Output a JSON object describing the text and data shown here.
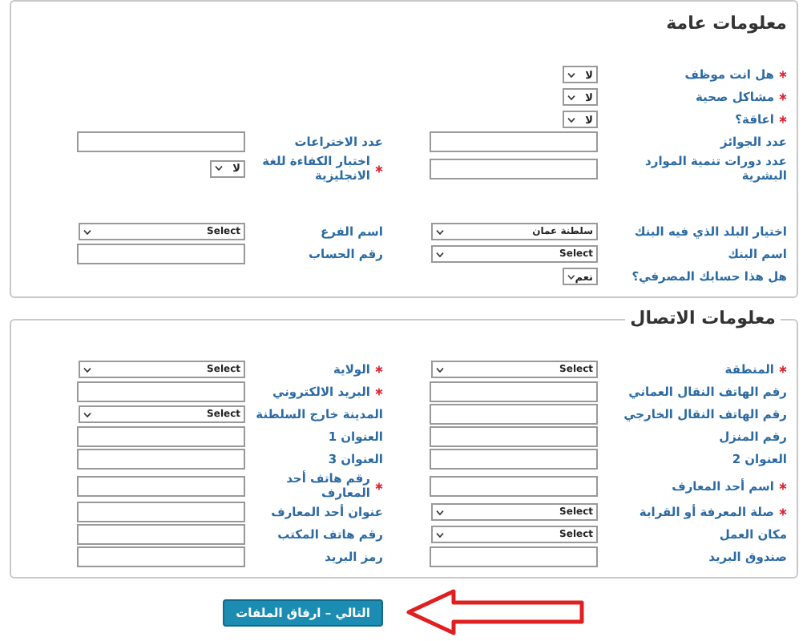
{
  "sections": [
    {
      "title": "معلومات عامة",
      "kind": "box",
      "rows": [
        {
          "kind": "fields",
          "cells": [
            {
              "label": "هل انت موظف",
              "required": true,
              "control": {
                "kind": "small-select",
                "value": "لا"
              }
            }
          ]
        },
        {
          "kind": "fields",
          "cells": [
            {
              "label": "مشاكل صحية",
              "required": true,
              "control": {
                "kind": "small-select",
                "value": "لا"
              }
            }
          ]
        },
        {
          "kind": "fields",
          "cells": [
            {
              "label": "اعاقة؟",
              "required": true,
              "control": {
                "kind": "small-select",
                "value": "لا"
              }
            }
          ]
        },
        {
          "kind": "fields",
          "cells": [
            {
              "label": "عدد الجوائز",
              "required": false,
              "control": {
                "kind": "input"
              }
            },
            {
              "label": "عدد الاختراعات",
              "required": false,
              "control": {
                "kind": "input"
              }
            }
          ]
        },
        {
          "kind": "fields",
          "cells": [
            {
              "label": "عدد دورات تنمية الموارد البشرية",
              "required": false,
              "control": {
                "kind": "input"
              }
            },
            {
              "label": "اختبار الكفاءة للغة الانجليزية",
              "required": true,
              "control": {
                "kind": "small-select",
                "value": "لا"
              }
            }
          ]
        },
        {
          "kind": "gap"
        },
        {
          "kind": "fields",
          "cells": [
            {
              "label": "اختيار البلد الذي فيه البنك",
              "required": false,
              "control": {
                "kind": "select",
                "value": "سلطنة عمان"
              }
            },
            {
              "label": "اسم الفرع",
              "required": false,
              "control": {
                "kind": "select",
                "value": "Select"
              }
            }
          ]
        },
        {
          "kind": "fields",
          "cells": [
            {
              "label": "اسم البنك",
              "required": false,
              "control": {
                "kind": "select",
                "value": "Select"
              }
            },
            {
              "label": "رقم الحساب",
              "required": false,
              "control": {
                "kind": "input"
              }
            }
          ]
        },
        {
          "kind": "fields",
          "cells": [
            {
              "label": "هل هذا حسابك المصرفي؟",
              "required": false,
              "control": {
                "kind": "small-select",
                "value": "نعم"
              }
            }
          ]
        }
      ]
    },
    {
      "title": "معلومات الاتصال",
      "kind": "fieldset",
      "rows": [
        {
          "kind": "fields",
          "cells": [
            {
              "label": "المنطقة",
              "required": true,
              "control": {
                "kind": "select",
                "value": "Select"
              }
            },
            {
              "label": "الولاية",
              "required": true,
              "control": {
                "kind": "select",
                "value": "Select"
              }
            }
          ]
        },
        {
          "kind": "fields",
          "cells": [
            {
              "label": "رقم الهاتف النقال العماني",
              "required": false,
              "control": {
                "kind": "input"
              }
            },
            {
              "label": "البريد الالكتروني",
              "required": true,
              "control": {
                "kind": "input"
              }
            }
          ]
        },
        {
          "kind": "fields",
          "cells": [
            {
              "label": "رقم الهاتف النقال الخارجي",
              "required": false,
              "control": {
                "kind": "input"
              }
            },
            {
              "label": "المدينة خارج السلطنة",
              "required": false,
              "control": {
                "kind": "select",
                "value": "Select"
              }
            }
          ]
        },
        {
          "kind": "fields",
          "cells": [
            {
              "label": "رقم المنزل",
              "required": false,
              "control": {
                "kind": "input"
              }
            },
            {
              "label": "العنوان 1",
              "required": false,
              "control": {
                "kind": "input"
              }
            }
          ]
        },
        {
          "kind": "fields",
          "cells": [
            {
              "label": "العنوان 2",
              "required": false,
              "control": {
                "kind": "input"
              }
            },
            {
              "label": "العنوان 3",
              "required": false,
              "control": {
                "kind": "input"
              }
            }
          ]
        },
        {
          "kind": "fields",
          "cells": [
            {
              "label": "اسم أحد المعارف",
              "required": true,
              "control": {
                "kind": "input"
              }
            },
            {
              "label": "رقم هاتف أحد المعارف",
              "required": true,
              "control": {
                "kind": "input"
              }
            }
          ]
        },
        {
          "kind": "fields",
          "cells": [
            {
              "label": "صلة المعرفة أو القرابة",
              "required": true,
              "control": {
                "kind": "select",
                "value": "Select"
              }
            },
            {
              "label": "عنوان أحد المعارف",
              "required": false,
              "control": {
                "kind": "input"
              }
            }
          ]
        },
        {
          "kind": "fields",
          "cells": [
            {
              "label": "مكان العمل",
              "required": false,
              "control": {
                "kind": "select",
                "value": "Select"
              }
            },
            {
              "label": "رقم هاتف المكتب",
              "required": false,
              "control": {
                "kind": "input"
              }
            }
          ]
        },
        {
          "kind": "fields",
          "cells": [
            {
              "label": "صندوق البريد",
              "required": false,
              "control": {
                "kind": "input"
              }
            },
            {
              "label": "رمز البريد",
              "required": false,
              "control": {
                "kind": "input"
              }
            }
          ]
        }
      ]
    }
  ],
  "next_button": {
    "label": "التالي – ارفاق الملفات"
  }
}
